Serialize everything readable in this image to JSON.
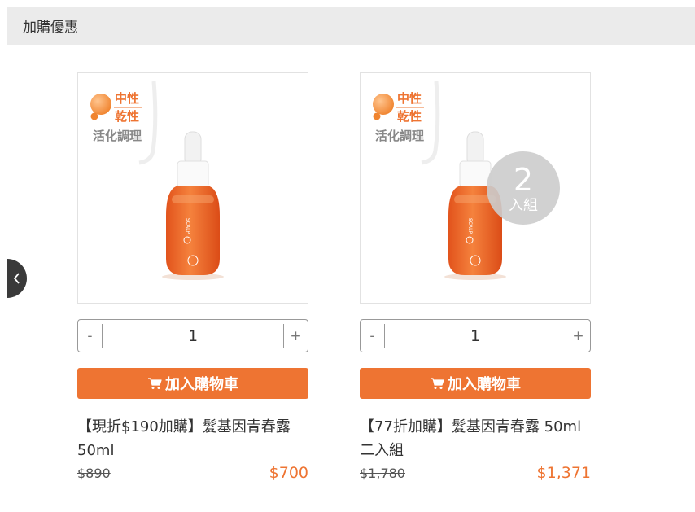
{
  "header": {
    "title": "加購優惠"
  },
  "badge": {
    "line1": "中性",
    "line2": "乾性",
    "line3": "活化調理"
  },
  "colors": {
    "accent": "#ee7432",
    "header_bg": "#ebebeb"
  },
  "icons": {
    "prev": "chevron-left-icon",
    "cart": "cart-icon"
  },
  "products": [
    {
      "qty_minus": "-",
      "qty_value": "1",
      "qty_plus": "+",
      "add_to_cart": "加入購物車",
      "title": "【現折$190加購】髮基因青春露 50ml",
      "old_price": "$890",
      "new_price": "$700"
    },
    {
      "bundle_number": "2",
      "bundle_label": "入組",
      "qty_minus": "-",
      "qty_value": "1",
      "qty_plus": "+",
      "add_to_cart": "加入購物車",
      "title": "【77折加購】髮基因青春露 50ml 二入組",
      "old_price": "$1,780",
      "new_price": "$1,371"
    }
  ]
}
